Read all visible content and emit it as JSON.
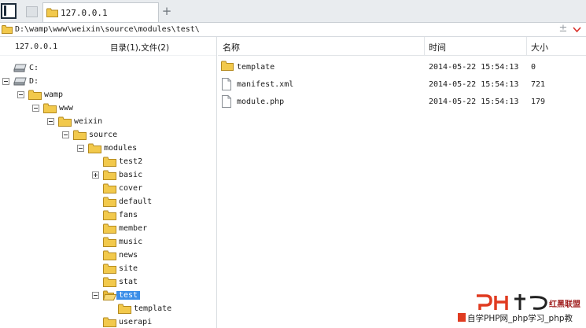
{
  "tab": {
    "title": "127.0.0.1",
    "add_label": "+"
  },
  "address": {
    "path": "D:\\wamp\\www\\weixin\\source\\modules\\test\\",
    "plus_label": "±"
  },
  "left_pane": {
    "host": "127.0.0.1",
    "count": "目录(1),文件(2)",
    "tree": [
      {
        "label": "C:",
        "type": "drive",
        "depth": 0,
        "expander": "none"
      },
      {
        "label": "D:",
        "type": "drive",
        "depth": 0,
        "expander": "minus"
      },
      {
        "label": "wamp",
        "type": "folder",
        "depth": 1,
        "expander": "minus"
      },
      {
        "label": "www",
        "type": "folder",
        "depth": 2,
        "expander": "minus"
      },
      {
        "label": "weixin",
        "type": "folder",
        "depth": 3,
        "expander": "minus"
      },
      {
        "label": "source",
        "type": "folder",
        "depth": 4,
        "expander": "minus"
      },
      {
        "label": "modules",
        "type": "folder",
        "depth": 5,
        "expander": "minus"
      },
      {
        "label": "test2",
        "type": "folder",
        "depth": 6,
        "expander": "none"
      },
      {
        "label": "basic",
        "type": "folder",
        "depth": 6,
        "expander": "plus"
      },
      {
        "label": "cover",
        "type": "folder",
        "depth": 6,
        "expander": "none"
      },
      {
        "label": "default",
        "type": "folder",
        "depth": 6,
        "expander": "none"
      },
      {
        "label": "fans",
        "type": "folder",
        "depth": 6,
        "expander": "none"
      },
      {
        "label": "member",
        "type": "folder",
        "depth": 6,
        "expander": "none"
      },
      {
        "label": "music",
        "type": "folder",
        "depth": 6,
        "expander": "none"
      },
      {
        "label": "news",
        "type": "folder",
        "depth": 6,
        "expander": "none"
      },
      {
        "label": "site",
        "type": "folder",
        "depth": 6,
        "expander": "none"
      },
      {
        "label": "stat",
        "type": "folder",
        "depth": 6,
        "expander": "none"
      },
      {
        "label": "test",
        "type": "folder-open",
        "depth": 6,
        "expander": "minus",
        "selected": true
      },
      {
        "label": "template",
        "type": "folder",
        "depth": 7,
        "expander": "none"
      },
      {
        "label": "userapi",
        "type": "folder",
        "depth": 6,
        "expander": "none"
      }
    ]
  },
  "right_pane": {
    "columns": {
      "name": "名称",
      "time": "时间",
      "size": "大小"
    },
    "files": [
      {
        "name": "template",
        "time": "2014-05-22 15:54:13",
        "size": "0",
        "type": "folder"
      },
      {
        "name": "manifest.xml",
        "time": "2014-05-22 15:54:13",
        "size": "721",
        "type": "file"
      },
      {
        "name": "module.php",
        "time": "2014-05-22 15:54:13",
        "size": "179",
        "type": "file"
      }
    ]
  },
  "watermark": {
    "brand": "红黑联盟",
    "tagline": "自学PHP网_php学习_php教"
  },
  "colors": {
    "folder": "#f2c94c",
    "selection": "#3b8ee8",
    "watermark_red": "#e03b20"
  }
}
